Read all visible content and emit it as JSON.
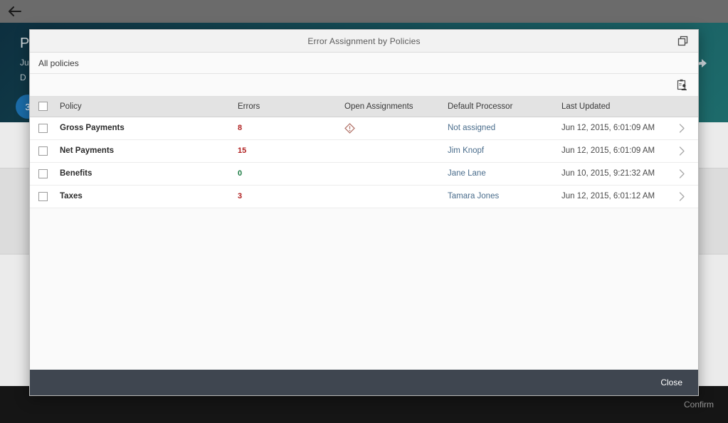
{
  "background": {
    "back_icon": "back-arrow-icon",
    "share_icon": "share-icon",
    "hero": {
      "title": "P",
      "line2": "Ju",
      "line3": "D",
      "badge_count": "3"
    },
    "footer": {
      "confirm_label": "Confirm"
    }
  },
  "dialog": {
    "title": "Error Assignment by Policies",
    "header_icon": "restore-window-icon",
    "subbar_label": "All policies",
    "toolbar_icon": "clipboard-person-icon",
    "columns": [
      "Policy",
      "Errors",
      "Open Assignments",
      "Default Processor",
      "Last Updated"
    ],
    "rows": [
      {
        "policy": "Gross Payments",
        "errors": "8",
        "errors_state": "high",
        "open_assignment_icon": "warning-diamond-icon",
        "has_open_assignment": true,
        "processor": "Not assigned",
        "last_updated": "Jun 12, 2015, 6:01:09 AM"
      },
      {
        "policy": "Net Payments",
        "errors": "15",
        "errors_state": "high",
        "open_assignment_icon": "",
        "has_open_assignment": false,
        "processor": "Jim Knopf",
        "last_updated": "Jun 12, 2015, 6:01:09 AM"
      },
      {
        "policy": "Benefits",
        "errors": "0",
        "errors_state": "zero",
        "open_assignment_icon": "",
        "has_open_assignment": false,
        "processor": "Jane Lane",
        "last_updated": "Jun 10, 2015, 9:21:32 AM"
      },
      {
        "policy": "Taxes",
        "errors": "3",
        "errors_state": "high",
        "open_assignment_icon": "",
        "has_open_assignment": false,
        "processor": "Tamara Jones",
        "last_updated": "Jun 12, 2015, 6:01:12 AM"
      }
    ],
    "footer": {
      "close_label": "Close"
    }
  },
  "colors": {
    "error_high": "#b02020",
    "error_zero": "#1a7a42",
    "link": "#4a6d8c",
    "warning": "#b5796f",
    "footer_bar": "#3f4650",
    "hero_gradient_start": "#0d2f3f",
    "hero_gradient_end": "#1d6b6b",
    "badge": "#1b6ca8"
  }
}
